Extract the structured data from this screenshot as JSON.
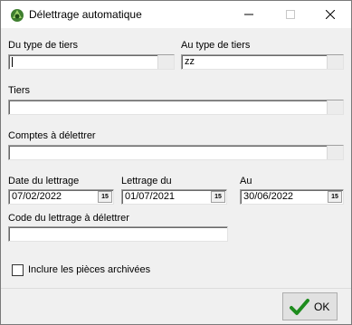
{
  "window": {
    "title": "Délettrage automatique"
  },
  "form": {
    "from_tier_type": {
      "label": "Du type de tiers",
      "value": ""
    },
    "to_tier_type": {
      "label": "Au type de tiers",
      "value": "zz"
    },
    "tiers": {
      "label": "Tiers",
      "value": ""
    },
    "accounts": {
      "label": "Comptes à délettrer",
      "value": ""
    },
    "lettering_date": {
      "label": "Date du lettrage",
      "value": "07/02/2022"
    },
    "lettering_from": {
      "label": "Lettrage du",
      "value": "01/07/2021"
    },
    "lettering_to": {
      "label": "Au",
      "value": "30/06/2022"
    },
    "lettering_code": {
      "label": "Code du lettrage à délettrer",
      "value": ""
    },
    "include_archived": {
      "label": "Inclure les pièces archivées",
      "checked": false
    },
    "calendar_glyph": "15"
  },
  "footer": {
    "ok_label": "OK"
  },
  "icons": {
    "app": "app-logo-icon",
    "minimize": "minimize-icon",
    "maximize": "maximize-icon",
    "close": "close-icon",
    "calendar": "calendar-icon",
    "ok": "checkmark-icon"
  },
  "colors": {
    "window_bg": "#f0f0f0",
    "ok_check": "#1e8c1e"
  }
}
